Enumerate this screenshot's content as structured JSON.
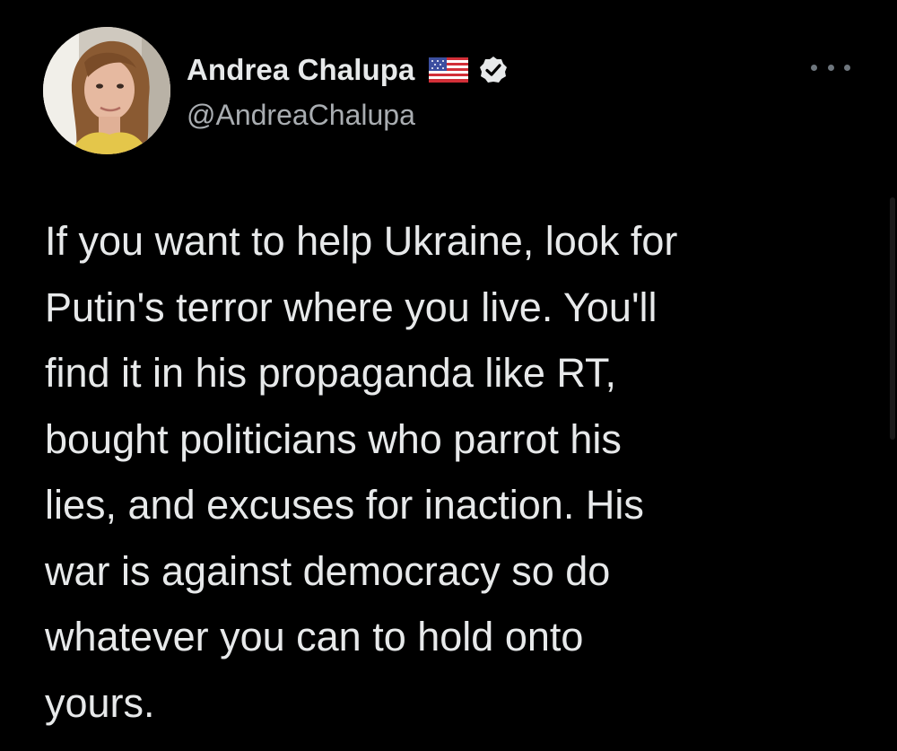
{
  "author": {
    "display_name": "Andrea Chalupa",
    "handle": "@AndreaChalupa",
    "flag_icon": "us-flag-icon",
    "verified_icon": "verified-badge-icon",
    "avatar_icon": "profile-photo"
  },
  "actions": {
    "more_icon": "more-options-icon"
  },
  "tweet": {
    "lines": [
      "If you want to help Ukraine, look for",
      "Putin's terror where you live. You'll",
      "find it in his propaganda like RT,",
      "bought politicians who parrot his",
      "lies, and excuses for inaction. His",
      "war is against democracy so do",
      "whatever you can to hold onto",
      "yours."
    ]
  },
  "colors": {
    "background": "#000000",
    "text_primary": "#e7e9ea",
    "text_secondary": "#a9adb1"
  }
}
